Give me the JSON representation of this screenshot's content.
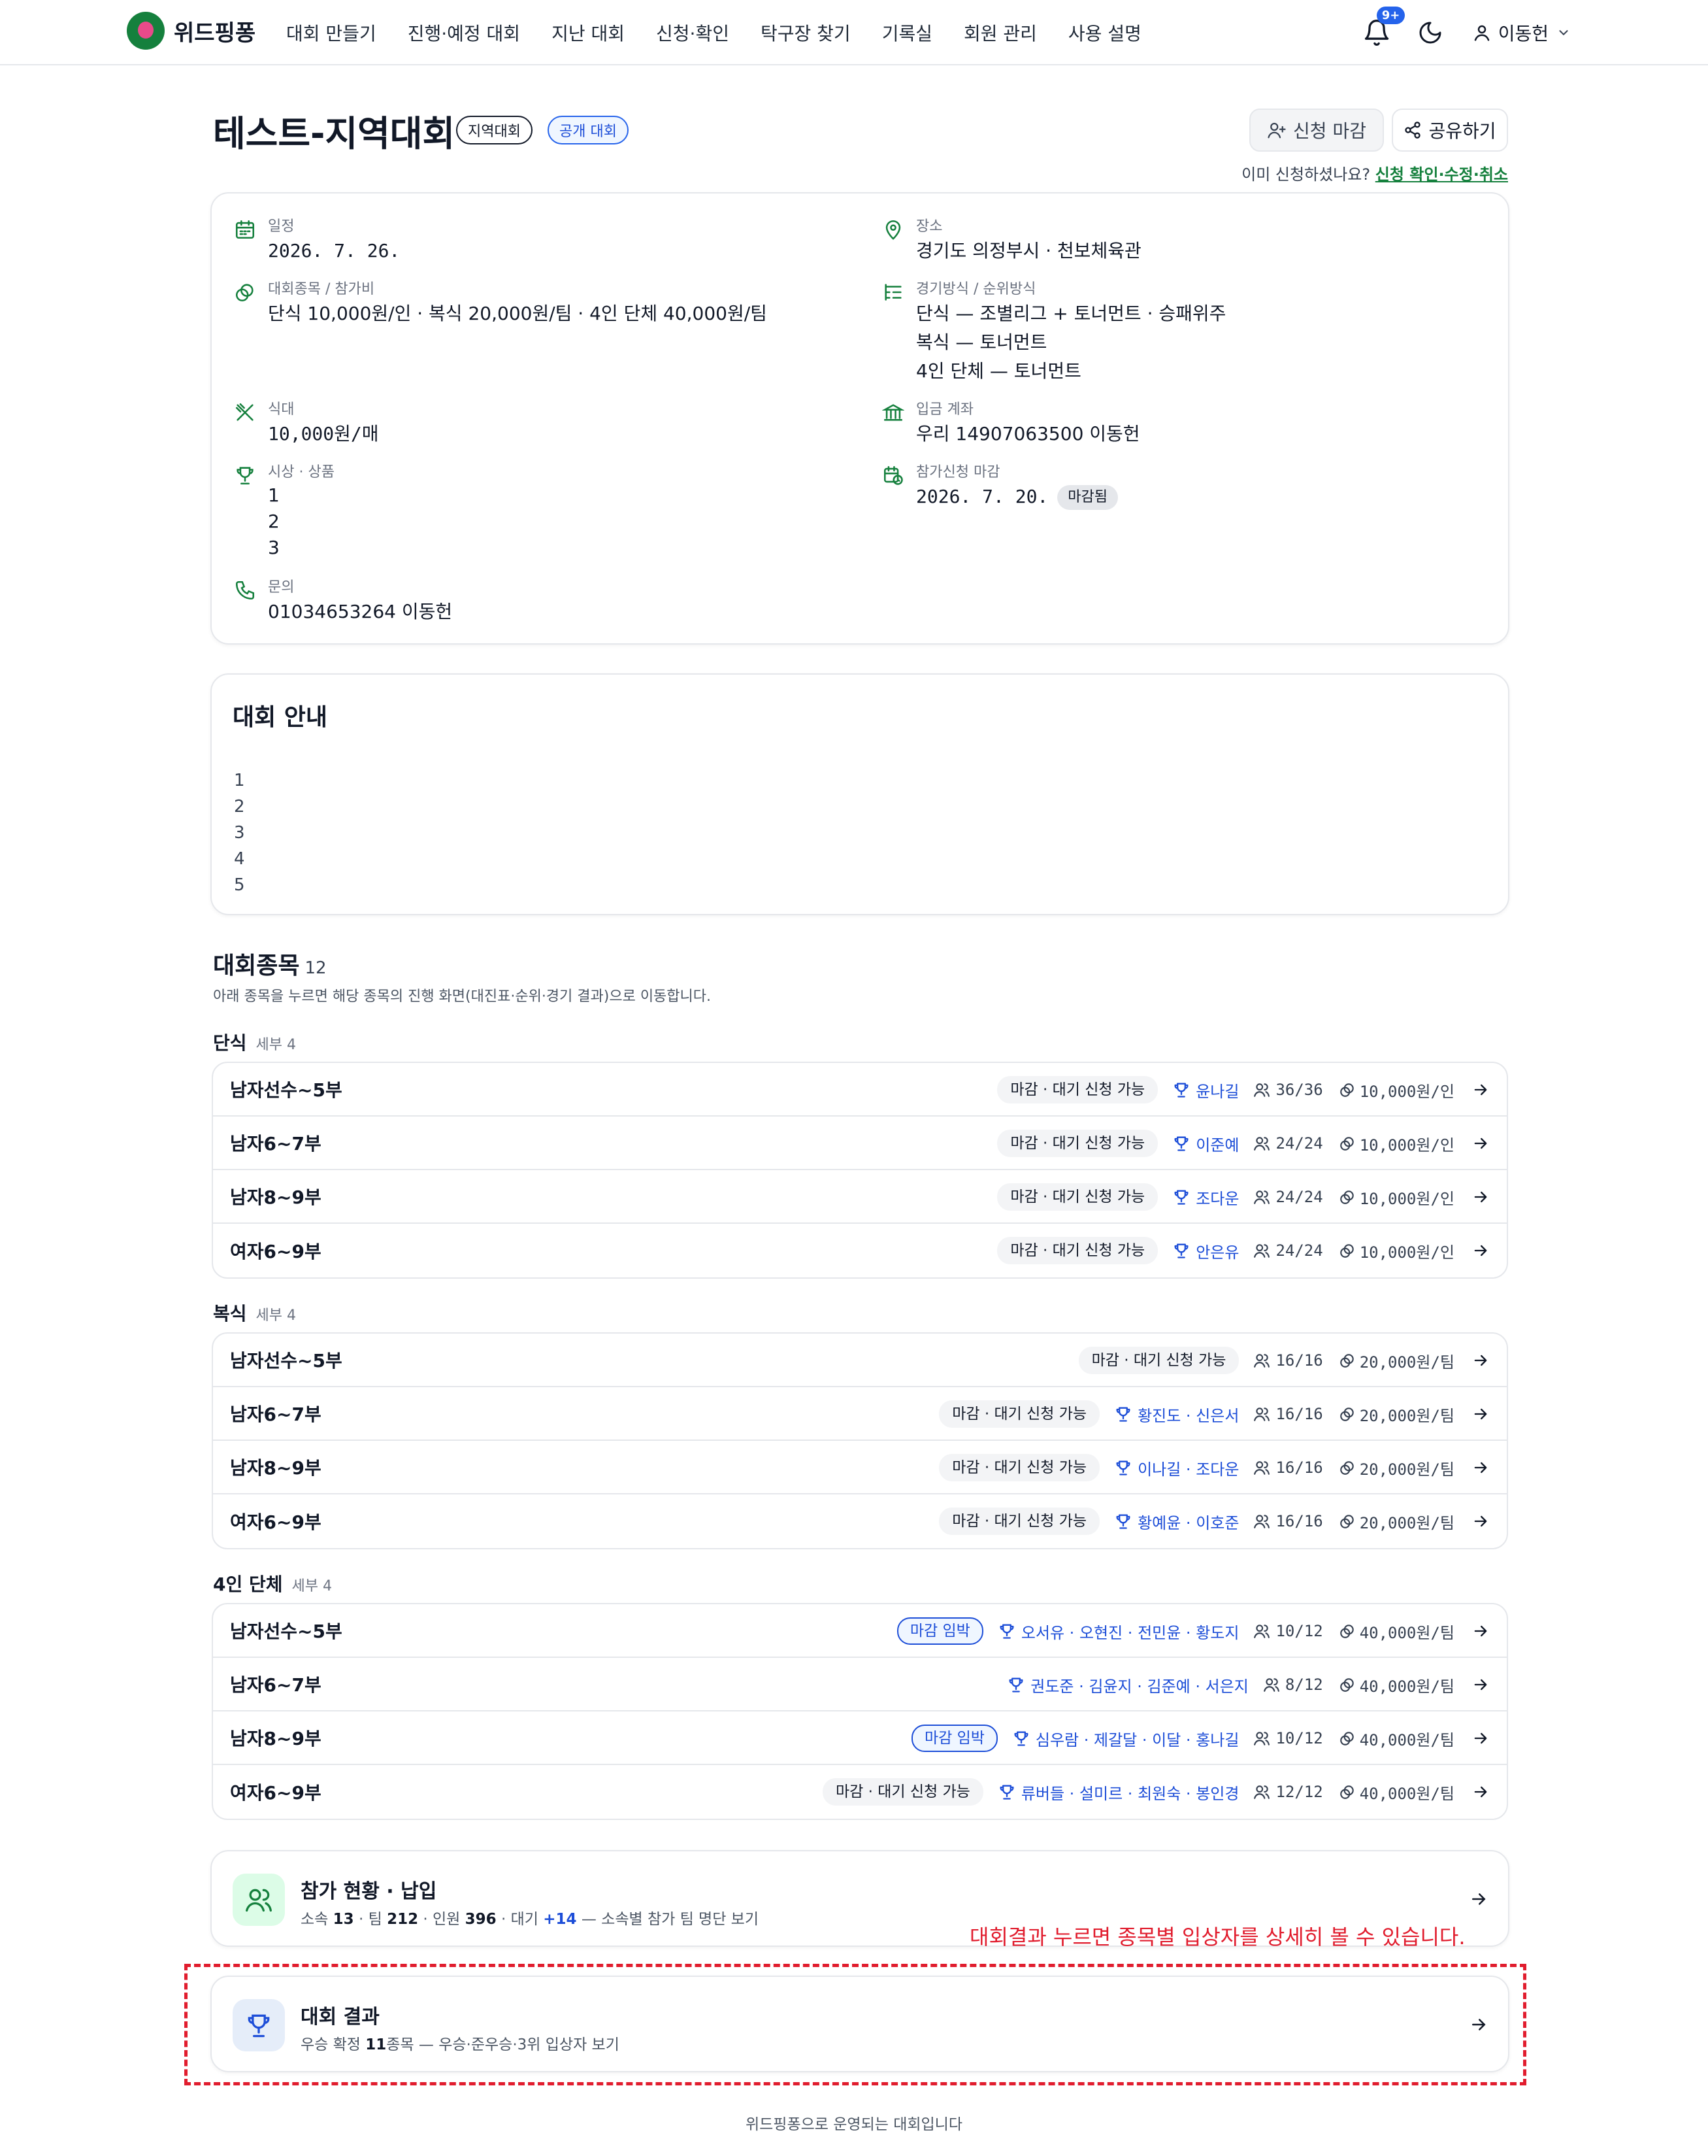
{
  "nav": {
    "brand": "위드핑퐁",
    "menu": [
      "대회 만들기",
      "진행·예정 대회",
      "지난 대회",
      "신청·확인",
      "탁구장 찾기",
      "기록실",
      "회원 관리",
      "사용 설명"
    ],
    "notif_count": "9+",
    "user": "이동헌",
    "icons": [
      "bell-icon",
      "moon-icon",
      "user-icon",
      "chevron-down-icon"
    ]
  },
  "header": {
    "title": "테스트-지역대회",
    "tag_region": "지역대회",
    "tag_public": "공개 대회",
    "close_button": "신청 마감",
    "share_button": "공유하기",
    "already_text": "이미 신청하셨나요?",
    "already_link": "신청 확인·수정·취소"
  },
  "info": {
    "date_label": "일정",
    "date_value": "2026. 7. 26.",
    "place_label": "장소",
    "place_value": "경기도 의정부시 · 천보체육관",
    "events_label": "대회종목 / 참가비",
    "events_value": "단식 10,000원/인 · 복식 20,000원/팀 · 4인 단체 40,000원/팀",
    "format_label": "경기방식 / 순위방식",
    "format_lines": [
      "단식 — 조별리그 + 토너먼트 · 승패위주",
      "복식 — 토너먼트",
      "4인 단체 — 토너먼트"
    ],
    "meal_label": "식대",
    "meal_value": "10,000원/매",
    "account_label": "입금 계좌",
    "account_value": "우리 14907063500 이동헌",
    "prize_label": "시상 · 상품",
    "prize_lines": [
      "1",
      "2",
      "3"
    ],
    "deadline_label": "참가신청 마감",
    "deadline_value": "2026. 7. 20.",
    "deadline_status": "마감됨",
    "contact_label": "문의",
    "contact_value": "01034653264 이동헌"
  },
  "guide": {
    "title": "대회 안내",
    "lines": [
      "1",
      "2",
      "3",
      "4",
      "5"
    ]
  },
  "events_section": {
    "title": "대회종목",
    "count": "12",
    "desc": "아래 종목을 누르면 해당 종목의 진행 화면(대진표·순위·경기 결과)으로 이동합니다.",
    "groups": [
      {
        "name": "단식",
        "sub_label": "세부",
        "sub_count": "4",
        "rows": [
          {
            "name": "남자선수~5부",
            "status": "마감 · 대기 신청 가능",
            "urgent": false,
            "winner": "윤나길",
            "count": "36/36",
            "fee": "10,000원/인"
          },
          {
            "name": "남자6~7부",
            "status": "마감 · 대기 신청 가능",
            "urgent": false,
            "winner": "이준예",
            "count": "24/24",
            "fee": "10,000원/인"
          },
          {
            "name": "남자8~9부",
            "status": "마감 · 대기 신청 가능",
            "urgent": false,
            "winner": "조다운",
            "count": "24/24",
            "fee": "10,000원/인"
          },
          {
            "name": "여자6~9부",
            "status": "마감 · 대기 신청 가능",
            "urgent": false,
            "winner": "안은유",
            "count": "24/24",
            "fee": "10,000원/인"
          }
        ]
      },
      {
        "name": "복식",
        "sub_label": "세부",
        "sub_count": "4",
        "rows": [
          {
            "name": "남자선수~5부",
            "status": "마감 · 대기 신청 가능",
            "urgent": false,
            "winner": "",
            "count": "16/16",
            "fee": "20,000원/팀"
          },
          {
            "name": "남자6~7부",
            "status": "마감 · 대기 신청 가능",
            "urgent": false,
            "winner": "황진도 · 신은서",
            "count": "16/16",
            "fee": "20,000원/팀"
          },
          {
            "name": "남자8~9부",
            "status": "마감 · 대기 신청 가능",
            "urgent": false,
            "winner": "이나길 · 조다운",
            "count": "16/16",
            "fee": "20,000원/팀"
          },
          {
            "name": "여자6~9부",
            "status": "마감 · 대기 신청 가능",
            "urgent": false,
            "winner": "황예윤 · 이호준",
            "count": "16/16",
            "fee": "20,000원/팀"
          }
        ]
      },
      {
        "name": "4인 단체",
        "sub_label": "세부",
        "sub_count": "4",
        "rows": [
          {
            "name": "남자선수~5부",
            "status": "마감 임박",
            "urgent": true,
            "winner": "오서유 · 오현진 · 전민윤 · 황도지",
            "count": "10/12",
            "fee": "40,000원/팀"
          },
          {
            "name": "남자6~7부",
            "status": "",
            "urgent": false,
            "winner": "권도준 · 김윤지 · 김준예 · 서은지",
            "count": "8/12",
            "fee": "40,000원/팀"
          },
          {
            "name": "남자8~9부",
            "status": "마감 임박",
            "urgent": true,
            "winner": "심우람 · 제갈달 · 이달 · 홍나길",
            "count": "10/12",
            "fee": "40,000원/팀"
          },
          {
            "name": "여자6~9부",
            "status": "마감 · 대기 신청 가능",
            "urgent": false,
            "winner": "류버들 · 설미르 · 최원숙 · 봉인경",
            "count": "12/12",
            "fee": "40,000원/팀"
          }
        ]
      }
    ]
  },
  "participation": {
    "title": "참가 현황 · 납입",
    "sub_pre1": "소속 ",
    "clubs": "13",
    "sub_pre2": " · 팀 ",
    "teams": "212",
    "sub_pre3": " · 인원 ",
    "people": "396",
    "sub_pre4": " · 대기 ",
    "waiting": "+14",
    "sub_post": " — 소속별 참가 팀 명단 보기"
  },
  "results": {
    "title": "대회 결과",
    "sub_pre": "우승 확정 ",
    "confirmed": "11",
    "sub_post": "종목 — 우승·준우승·3위 입상자 보기"
  },
  "annotation": "대회결과 누르면 종목별 입상자를 상세히 볼 수 있습니다.",
  "footer": "위드핑퐁으로 운영되는 대회입니다",
  "colors": {
    "accent": "#15803d",
    "link_blue": "#1d4ed8",
    "annotation_red": "#e11d2e"
  }
}
